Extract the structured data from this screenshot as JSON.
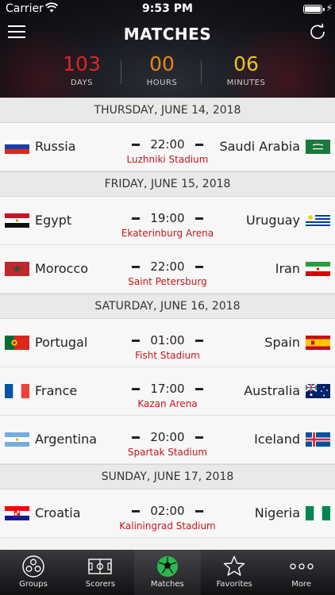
{
  "status_bar": {
    "carrier": "Carrier",
    "time": "9:53 PM"
  },
  "header": {
    "title": "MATCHES"
  },
  "countdown": [
    {
      "value": "103",
      "label": "DAYS",
      "color": "#e0242b"
    },
    {
      "value": "00",
      "label": "HOURS",
      "color": "#e58a1a"
    },
    {
      "value": "06",
      "label": "MINUTES",
      "color": "#f0c419"
    }
  ],
  "days": [
    {
      "date": "THURSDAY, JUNE 14, 2018",
      "matches": [
        {
          "home": "Russia",
          "away": "Saudi Arabia",
          "time": "22:00",
          "venue": "Luzhniki Stadium",
          "home_flag": "russia-flag",
          "away_flag": "saudi-arabia-flag"
        }
      ]
    },
    {
      "date": "FRIDAY, JUNE 15, 2018",
      "matches": [
        {
          "home": "Egypt",
          "away": "Uruguay",
          "time": "19:00",
          "venue": "Ekaterinburg Arena",
          "home_flag": "egypt-flag",
          "away_flag": "uruguay-flag"
        },
        {
          "home": "Morocco",
          "away": "Iran",
          "time": "22:00",
          "venue": "Saint Petersburg",
          "home_flag": "morocco-flag",
          "away_flag": "iran-flag"
        }
      ]
    },
    {
      "date": "SATURDAY, JUNE 16, 2018",
      "matches": [
        {
          "home": "Portugal",
          "away": "Spain",
          "time": "01:00",
          "venue": "Fisht Stadium",
          "home_flag": "portugal-flag",
          "away_flag": "spain-flag"
        },
        {
          "home": "France",
          "away": "Australia",
          "time": "17:00",
          "venue": "Kazan Arena",
          "home_flag": "france-flag",
          "away_flag": "australia-flag"
        },
        {
          "home": "Argentina",
          "away": "Iceland",
          "time": "20:00",
          "venue": "Spartak Stadium",
          "home_flag": "argentina-flag",
          "away_flag": "iceland-flag"
        }
      ]
    },
    {
      "date": "SUNDAY, JUNE 17, 2018",
      "matches": [
        {
          "home": "Croatia",
          "away": "Nigeria",
          "time": "02:00",
          "venue": "Kaliningrad Stadium",
          "home_flag": "croatia-flag",
          "away_flag": "nigeria-flag"
        }
      ]
    }
  ],
  "tabs": [
    {
      "label": "Groups",
      "icon": "groups-icon",
      "active": false
    },
    {
      "label": "Scorers",
      "icon": "pitch-icon",
      "active": false
    },
    {
      "label": "Matches",
      "icon": "football-icon",
      "active": true
    },
    {
      "label": "Favorites",
      "icon": "star-icon",
      "active": false
    },
    {
      "label": "More",
      "icon": "more-icon",
      "active": false
    }
  ],
  "colors": {
    "venue": "#c4161c",
    "accent_green": "#2db84d"
  }
}
